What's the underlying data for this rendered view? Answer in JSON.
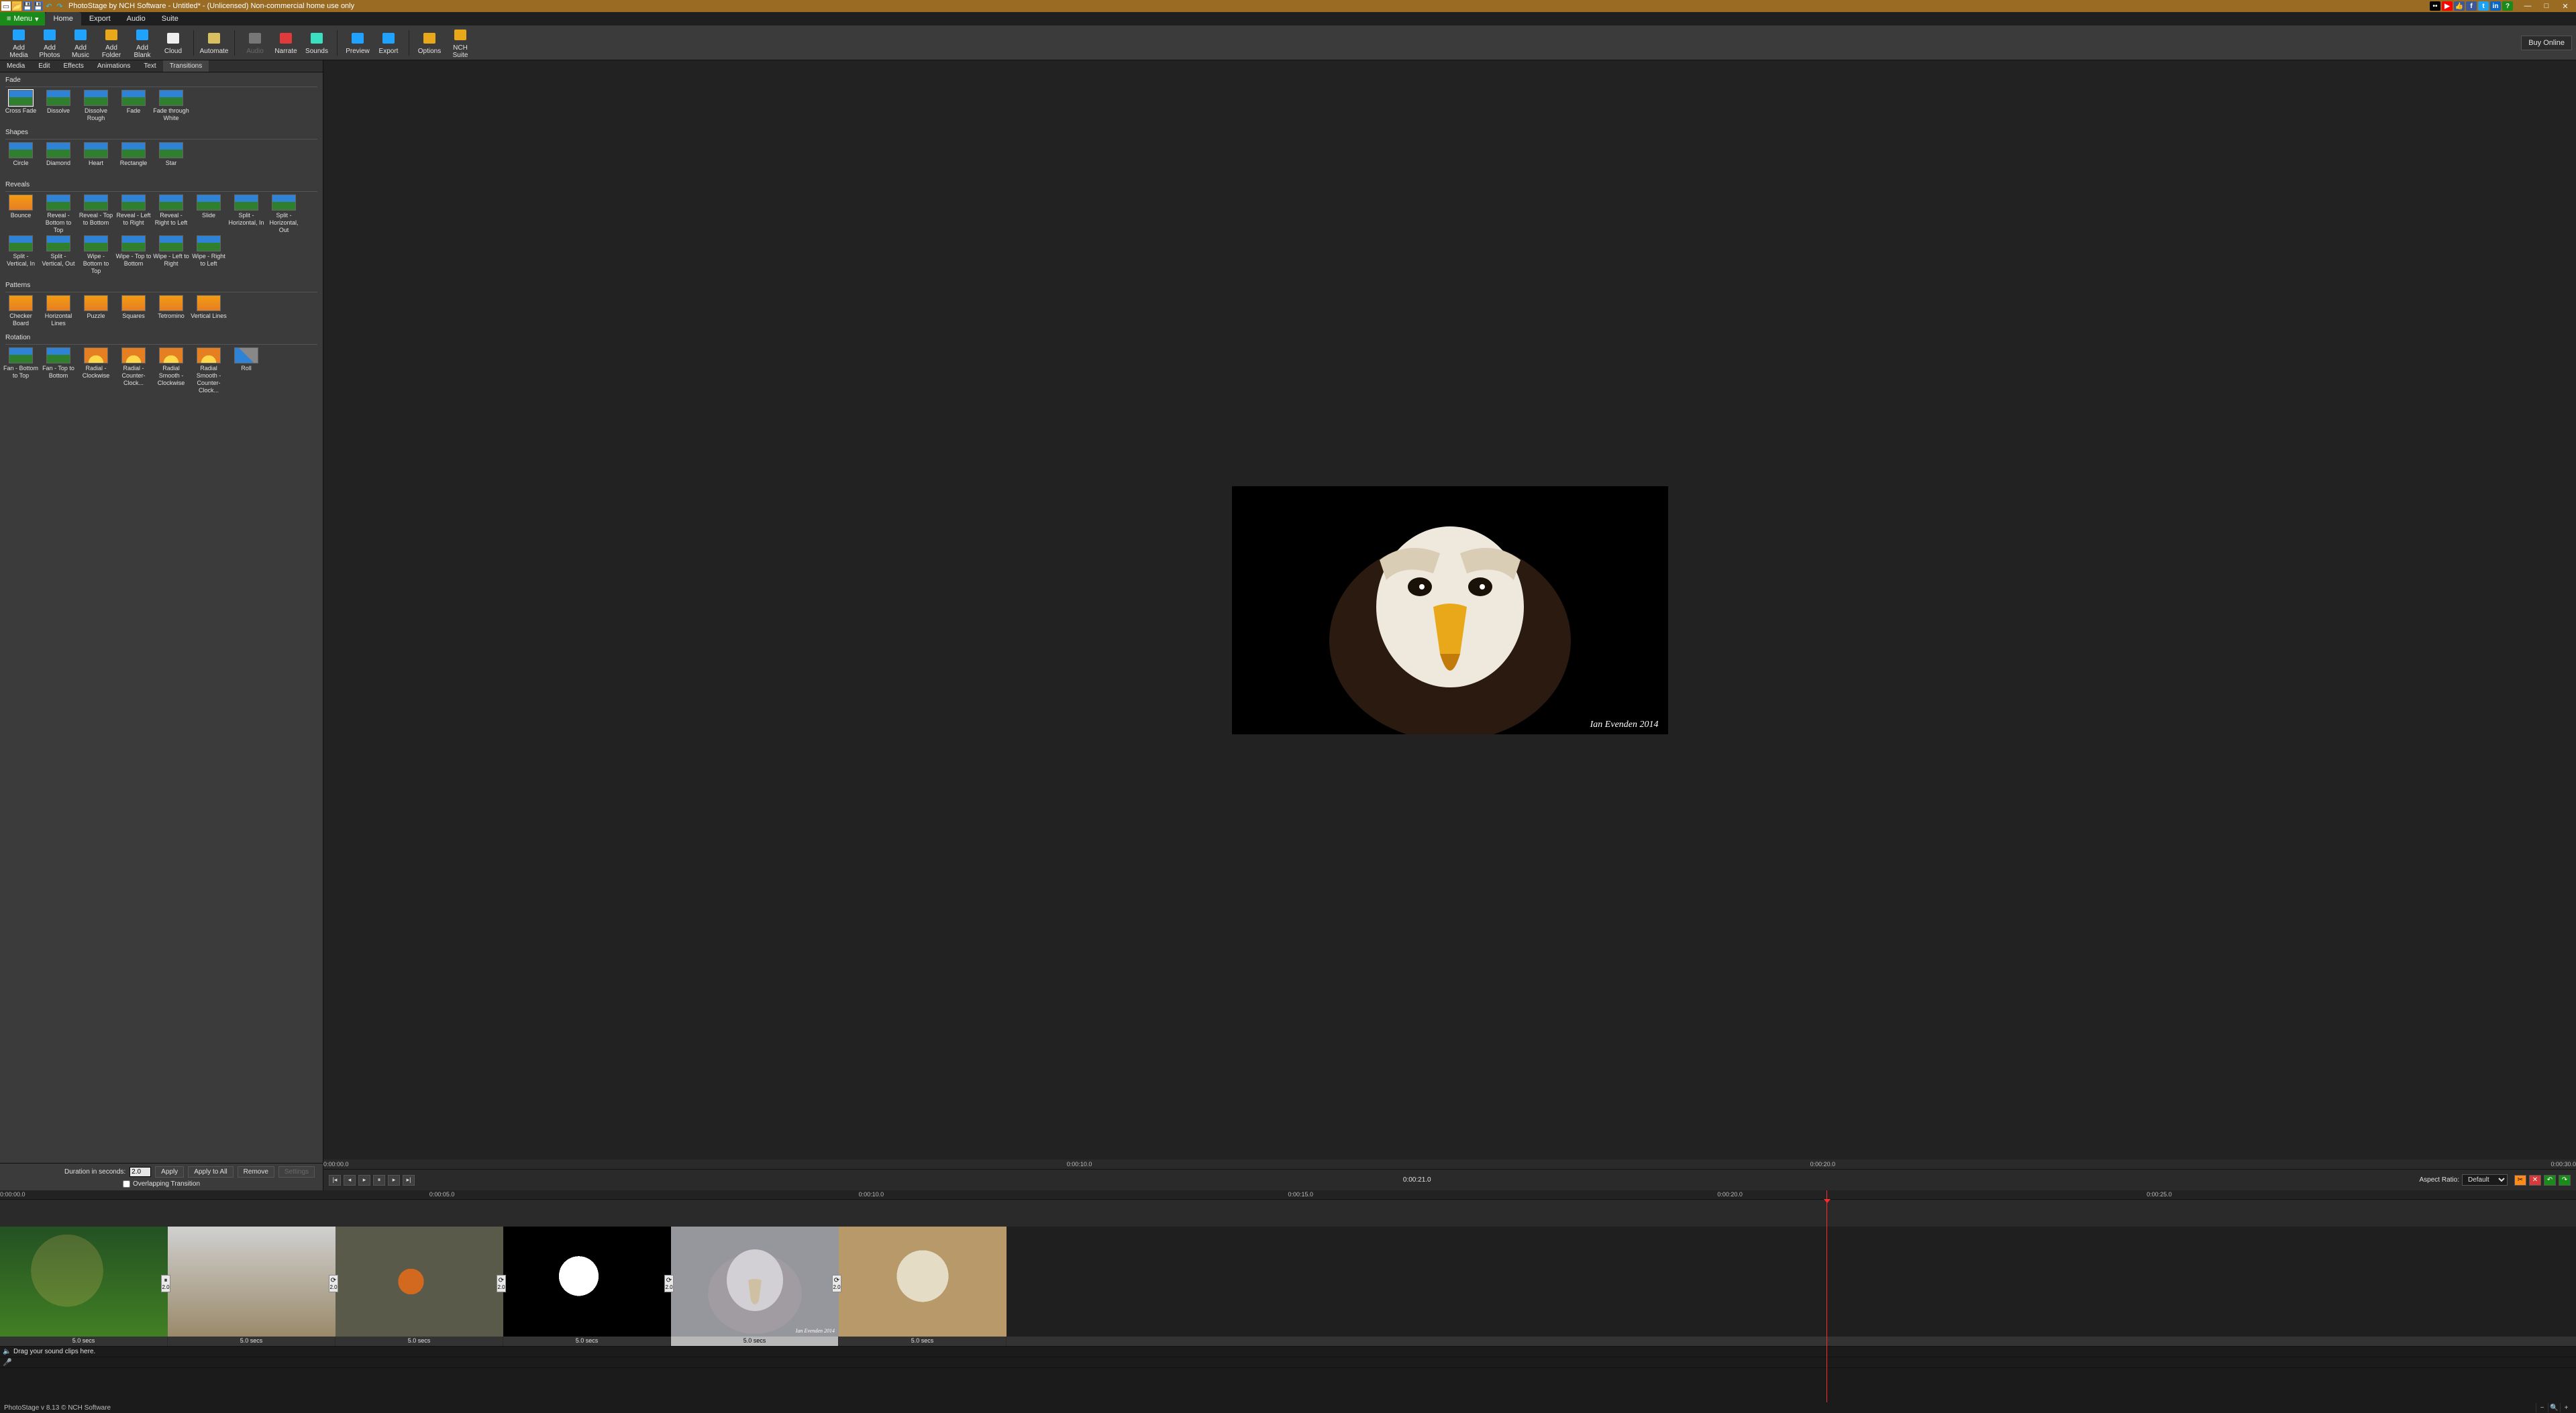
{
  "title": "PhotoStage by NCH Software - Untitled* - (Unlicensed) Non-commercial home use only",
  "menubar": {
    "menu_label": "Menu",
    "tabs": [
      "Home",
      "Export",
      "Audio",
      "Suite"
    ],
    "active": 0
  },
  "ribbon": {
    "buttons": [
      {
        "label": "Add Media",
        "icon": "add-media-icon"
      },
      {
        "label": "Add Photos",
        "icon": "add-photos-icon"
      },
      {
        "label": "Add Music",
        "icon": "add-music-icon"
      },
      {
        "label": "Add Folder",
        "icon": "add-folder-icon"
      },
      {
        "label": "Add Blank",
        "icon": "add-blank-icon"
      },
      {
        "label": "Cloud",
        "icon": "cloud-icon"
      },
      {
        "label": "Automate",
        "icon": "automate-icon"
      },
      {
        "label": "Audio",
        "icon": "audio-speaker-icon",
        "disabled": true
      },
      {
        "label": "Narrate",
        "icon": "narrate-icon"
      },
      {
        "label": "Sounds",
        "icon": "sounds-icon"
      },
      {
        "label": "Preview",
        "icon": "preview-play-icon"
      },
      {
        "label": "Export",
        "icon": "export-icon"
      },
      {
        "label": "Options",
        "icon": "options-icon"
      },
      {
        "label": "NCH Suite",
        "icon": "nch-suite-icon"
      }
    ],
    "separators_after": [
      5,
      6,
      9,
      11
    ],
    "buy_label": "Buy Online"
  },
  "left_panel": {
    "subtabs": [
      "Media",
      "Edit",
      "Effects",
      "Animations",
      "Text",
      "Transitions"
    ],
    "active_subtab": 5,
    "sections": [
      {
        "title": "Fade",
        "items": [
          {
            "label": "Cross Fade",
            "sel": true
          },
          {
            "label": "Dissolve"
          },
          {
            "label": "Dissolve Rough"
          },
          {
            "label": "Fade"
          },
          {
            "label": "Fade through White"
          }
        ]
      },
      {
        "title": "Shapes",
        "items": [
          {
            "label": "Circle"
          },
          {
            "label": "Diamond"
          },
          {
            "label": "Heart"
          },
          {
            "label": "Rectangle"
          },
          {
            "label": "Star"
          }
        ]
      },
      {
        "title": "Reveals",
        "items": [
          {
            "label": "Bounce",
            "style": "orange"
          },
          {
            "label": "Reveal - Bottom to Top"
          },
          {
            "label": "Reveal - Top to Bottom"
          },
          {
            "label": "Reveal - Left to Right"
          },
          {
            "label": "Reveal - Right to Left"
          },
          {
            "label": "Slide"
          },
          {
            "label": "Split - Horizontal, In"
          },
          {
            "label": "Split - Horizontal, Out"
          },
          {
            "label": "Split - Vertical, In"
          },
          {
            "label": "Split - Vertical, Out"
          },
          {
            "label": "Wipe - Bottom to Top"
          },
          {
            "label": "Wipe - Top to Bottom"
          },
          {
            "label": "Wipe - Left to Right"
          },
          {
            "label": "Wipe - Right to Left"
          }
        ]
      },
      {
        "title": "Patterns",
        "items": [
          {
            "label": "Checker Board",
            "style": "orange"
          },
          {
            "label": "Horizontal Lines",
            "style": "orange"
          },
          {
            "label": "Puzzle",
            "style": "orange"
          },
          {
            "label": "Squares",
            "style": "orange"
          },
          {
            "label": "Tetromino",
            "style": "orange"
          },
          {
            "label": "Vertical Lines",
            "style": "orange"
          }
        ]
      },
      {
        "title": "Rotation",
        "items": [
          {
            "label": "Fan - Bottom to Top"
          },
          {
            "label": "Fan - Top to Bottom"
          },
          {
            "label": "Radial - Clockwise",
            "style": "sun"
          },
          {
            "label": "Radial - Counter-Clock...",
            "style": "sun"
          },
          {
            "label": "Radial Smooth - Clockwise",
            "style": "sun"
          },
          {
            "label": "Radial Smooth - Counter-Clock...",
            "style": "sun"
          },
          {
            "label": "Roll",
            "style": "roll"
          }
        ]
      }
    ],
    "footer": {
      "duration_label": "Duration in seconds:",
      "duration_value": "2.0",
      "apply": "Apply",
      "apply_all": "Apply to All",
      "remove": "Remove",
      "settings": "Settings",
      "overlap_label": "Overlapping Transition",
      "overlap_checked": false
    }
  },
  "preview": {
    "credit": "Ian Evenden 2014",
    "ruler": {
      "left": "0:00:00.0",
      "center": "0:00:10.0",
      "mid2": "0:00:20.0",
      "right": "0:00:30.0"
    },
    "playbar": {
      "current_time": "0:00:21.0",
      "aspect_label": "Aspect Ratio:",
      "aspect_value": "Default"
    }
  },
  "timeline": {
    "ruler": [
      "0:00:00.0",
      "0:00:05.0",
      "0:00:10.0",
      "0:00:15.0",
      "0:00:20.0",
      "0:00:25.0"
    ],
    "clips": [
      {
        "kind": "vulture1",
        "dur": "5.0 secs",
        "handle": "⏸",
        "hv": "2.0"
      },
      {
        "kind": "owl",
        "dur": "5.0 secs",
        "handle": "⟳",
        "hv": "2.0"
      },
      {
        "kind": "robin",
        "dur": "5.0 secs",
        "handle": "⟳",
        "hv": "2.0"
      },
      {
        "kind": "puffin",
        "dur": "5.0 secs",
        "handle": "⟳",
        "hv": "2.0"
      },
      {
        "kind": "eagle2",
        "dur": "5.0 secs",
        "handle": "⟳",
        "hv": "2.0",
        "selected": true,
        "credit": "Ian Evenden 2014"
      },
      {
        "kind": "vulture2",
        "dur": "5.0 secs"
      }
    ],
    "audio_hint": "Drag your sound clips here.",
    "playhead_pct": 70.9
  },
  "statusbar": {
    "text": "PhotoStage v 8.13  © NCH Software"
  }
}
